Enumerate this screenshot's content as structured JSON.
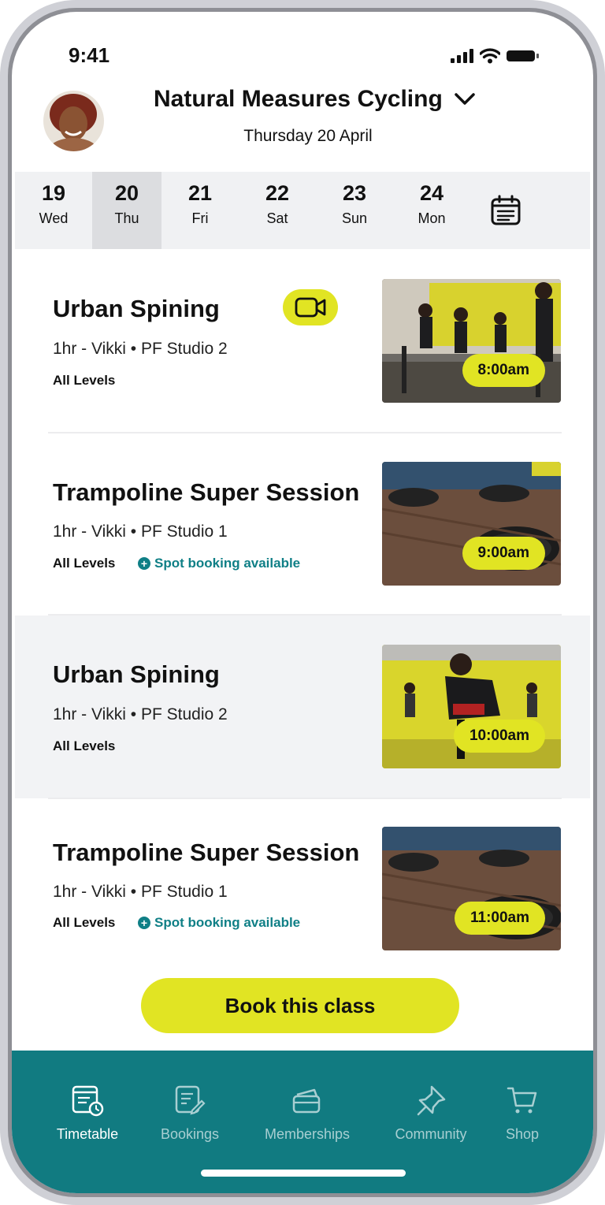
{
  "status_bar": {
    "time": "9:41"
  },
  "header": {
    "title": "Natural Measures Cycling",
    "date": "Thursday 20 April"
  },
  "days": [
    {
      "num": "19",
      "name": "Wed",
      "active": false
    },
    {
      "num": "20",
      "name": "Thu",
      "active": true
    },
    {
      "num": "21",
      "name": "Fri",
      "active": false
    },
    {
      "num": "22",
      "name": "Sat",
      "active": false
    },
    {
      "num": "23",
      "name": "Sun",
      "active": false
    },
    {
      "num": "24",
      "name": "Mon",
      "active": false
    }
  ],
  "classes": [
    {
      "title": "Urban Spining",
      "meta": "1hr - Vikki • PF Studio 2",
      "level": "All Levels",
      "spot": "",
      "time": "8:00am",
      "video": true
    },
    {
      "title": "Trampoline Super Session",
      "meta": "1hr - Vikki • PF Studio 1",
      "level": "All Levels",
      "spot": "Spot booking available",
      "time": "9:00am",
      "video": false
    },
    {
      "title": "Urban Spining",
      "meta": "1hr - Vikki • PF Studio 2",
      "level": "All Levels",
      "spot": "",
      "time": "10:00am",
      "video": false,
      "selected": true
    },
    {
      "title": "Trampoline Super Session",
      "meta": "1hr - Vikki • PF Studio 1",
      "level": "All Levels",
      "spot": "Spot booking available",
      "time": "11:00am",
      "video": false
    }
  ],
  "book_button": "Book this class",
  "nav": [
    {
      "label": "Timetable",
      "icon": "timetable-icon",
      "active": true
    },
    {
      "label": "Bookings",
      "icon": "bookings-icon",
      "active": false
    },
    {
      "label": "Memberships",
      "icon": "memberships-icon",
      "active": false
    },
    {
      "label": "Community",
      "icon": "community-icon",
      "active": false
    },
    {
      "label": "Shop",
      "icon": "shop-icon",
      "active": false
    }
  ],
  "colors": {
    "accent": "#e1e423",
    "brand": "#117b81",
    "link": "#0f7f86"
  }
}
